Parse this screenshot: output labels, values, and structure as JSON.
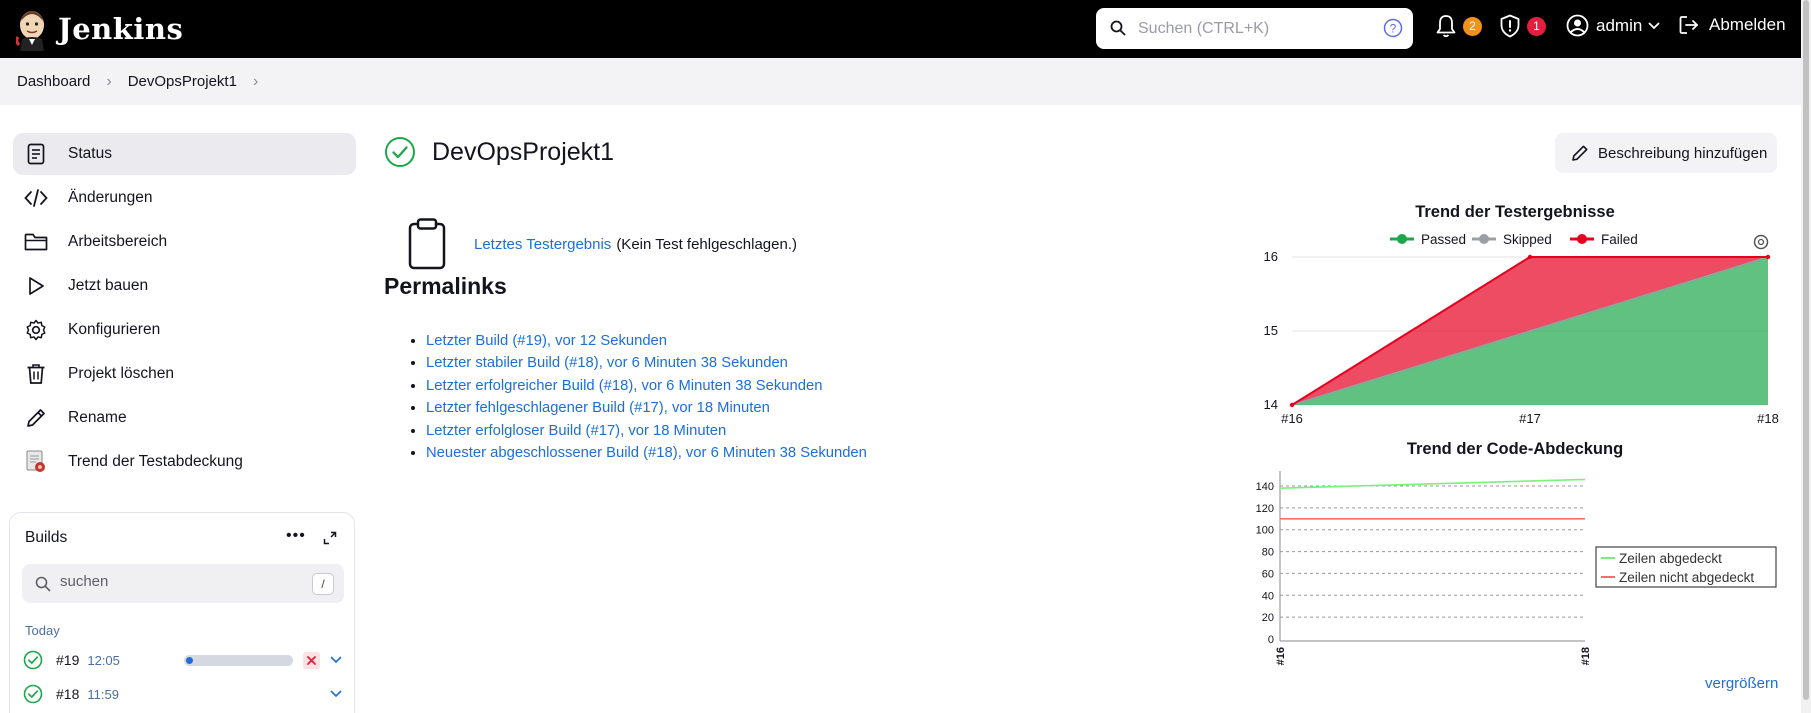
{
  "header": {
    "app_name": "Jenkins",
    "search_placeholder": "Suchen (CTRL+K)",
    "notifications_count": "2",
    "security_count": "1",
    "user": "admin",
    "logout": "Abmelden"
  },
  "breadcrumb": {
    "items": [
      "Dashboard",
      "DevOpsProjekt1"
    ]
  },
  "sidebar": {
    "items": [
      {
        "label": "Status",
        "icon": "status-icon"
      },
      {
        "label": "Änderungen",
        "icon": "code-icon"
      },
      {
        "label": "Arbeitsbereich",
        "icon": "folder-icon"
      },
      {
        "label": "Jetzt bauen",
        "icon": "play-icon"
      },
      {
        "label": "Konfigurieren",
        "icon": "gear-icon"
      },
      {
        "label": "Projekt löschen",
        "icon": "trash-icon"
      },
      {
        "label": "Rename",
        "icon": "pencil-icon"
      },
      {
        "label": "Trend der Testabdeckung",
        "icon": "coverage-icon"
      }
    ]
  },
  "builds": {
    "title": "Builds",
    "search_placeholder": "suchen",
    "shortcut": "/",
    "group_label": "Today",
    "rows": [
      {
        "number": "#19",
        "time": "12:05",
        "running": true,
        "progress": 0.05
      },
      {
        "number": "#18",
        "time": "11:59",
        "running": false
      }
    ]
  },
  "main": {
    "title": "DevOpsProjekt1",
    "add_description": "Beschreibung hinzufügen",
    "test_result_link": "Letztes Testergebnis",
    "test_result_note": "(Kein Test fehlgeschlagen.)",
    "permalinks_title": "Permalinks",
    "permalinks": [
      "Letzter Build (#19), vor 12 Sekunden",
      "Letzter stabiler Build (#18), vor 6 Minuten 38 Sekunden",
      "Letzter erfolgreicher Build (#18), vor 6 Minuten 38 Sekunden",
      "Letzter fehlgeschlagener Build (#17), vor 18 Minuten",
      "Letzter erfolgloser Build (#17), vor 18 Minuten",
      "Neuester abgeschlossener Build (#18), vor 6 Minuten 38 Sekunden"
    ],
    "zoom_link": "vergrößern"
  },
  "colors": {
    "passed": "#1ea64b",
    "skipped": "#9aa0a6",
    "failed": "#e6001f",
    "link": "#1c6fd6",
    "success_green": "#1ea64b"
  },
  "chart_data": [
    {
      "type": "area",
      "title": "Trend der Testergebnisse",
      "categories": [
        "#16",
        "#17",
        "#18"
      ],
      "series": [
        {
          "name": "Passed",
          "values": [
            14,
            15,
            16
          ]
        },
        {
          "name": "Skipped",
          "values": [
            0,
            0,
            0
          ]
        },
        {
          "name": "Failed",
          "values": [
            0,
            1,
            0
          ]
        }
      ],
      "ylim": [
        14,
        16
      ],
      "yticks": [
        14,
        15,
        16
      ],
      "legend": "top"
    },
    {
      "type": "line",
      "title": "Trend der Code-Abdeckung",
      "categories": [
        "#16",
        "#18"
      ],
      "series": [
        {
          "name": "Zeilen abgedeckt",
          "values": [
            138,
            146
          ]
        },
        {
          "name": "Zeilen nicht abgedeckt",
          "values": [
            110,
            110
          ]
        }
      ],
      "ylim": [
        0,
        140
      ],
      "yticks": [
        0,
        20,
        40,
        60,
        80,
        100,
        120,
        140
      ],
      "legend": "right"
    }
  ]
}
